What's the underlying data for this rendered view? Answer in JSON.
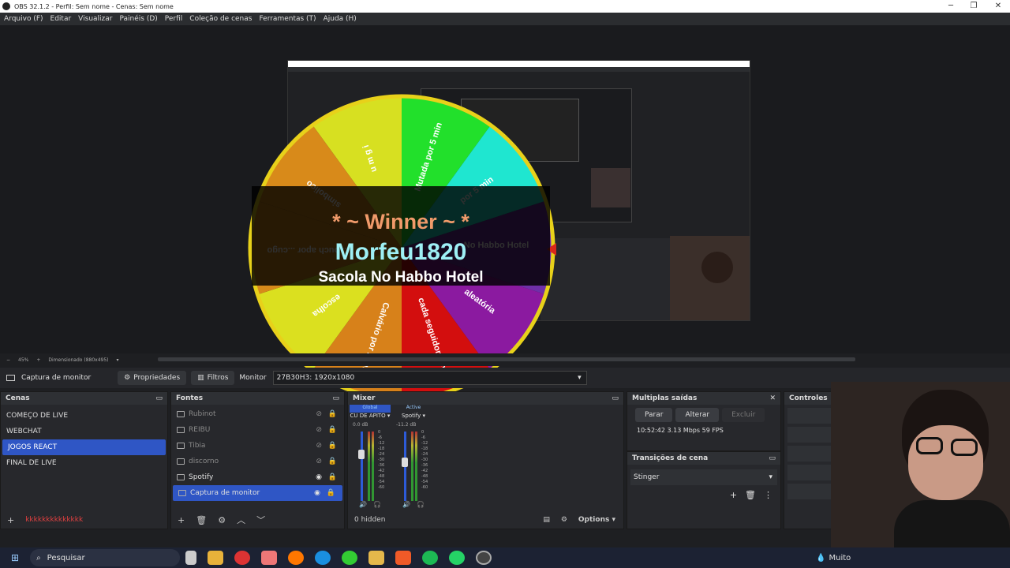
{
  "window": {
    "title": "OBS 32.1.2 - Perfil: Sem nome - Cenas: Sem nome",
    "min": "─",
    "max": "❐",
    "close": "✕"
  },
  "menu": [
    "Arquivo (F)",
    "Editar",
    "Visualizar",
    "Painéis (D)",
    "Perfil",
    "Coleção de cenas",
    "Ferramentas (T)",
    "Ajuda (H)"
  ],
  "wheel": {
    "winner_label": "* ~ Winner ~ *",
    "winner_name": "Morfeu1820",
    "prize": "Sacola No Habbo Hotel",
    "segments": [
      "u m g i",
      "Mutada por 5 min",
      "por 5 min",
      "No Habbo Hotel",
      "aleatória",
      "cada seguidor novo",
      "Calvário por 2 min",
      "escolha",
      "...ouch apor ...cugo",
      "simbolico"
    ],
    "segment_colors": [
      "#d7e021",
      "#22e02b",
      "#1fe6d0",
      "#6f2fa8",
      "#8b1aa0",
      "#d30e0e",
      "#d7811a",
      "#dbe01f",
      "#d78a1a",
      "#d88a1a"
    ],
    "rim_color": "#e8d11a"
  },
  "preview_status": {
    "zoom": "45%",
    "mode": "Dimensionado (880x495)"
  },
  "source_toolbar": {
    "source": "Captura de monitor",
    "properties": "Propriedades",
    "filters": "Filtros",
    "monitor_label": "Monitor",
    "monitor_value": "27B30H3: 1920x1080"
  },
  "scenes": {
    "title": "Cenas",
    "items": [
      "COMEÇO DE LIVE",
      "WEBCHAT",
      "JOGOS REACT",
      "FINAL DE LIVE"
    ],
    "selected": 2,
    "chat_overlay": "kkkkkkkkkkkkkk"
  },
  "sources": {
    "title": "Fontes",
    "items": [
      {
        "name": "Rubinot",
        "visible": false
      },
      {
        "name": "REIBU",
        "visible": false
      },
      {
        "name": "Tibia",
        "visible": false
      },
      {
        "name": "discorno",
        "visible": false
      },
      {
        "name": "Spotify",
        "visible": true
      },
      {
        "name": "Captura de monitor",
        "visible": true
      }
    ]
  },
  "mixer": {
    "title": "Mixer",
    "channels": [
      {
        "tag": "Global",
        "name": "CU DE APITO",
        "db": "0.0 dB",
        "level": 0.72
      },
      {
        "tag": "Active",
        "name": "Spotify",
        "db": "-11.2 dB",
        "level": 0.6
      }
    ],
    "scale": [
      "0",
      "-6",
      "-12",
      "-18",
      "-24",
      "-30",
      "-36",
      "-42",
      "-48",
      "-54",
      "-60"
    ],
    "hidden_count": "0 hidden",
    "options": "Options"
  },
  "outputs": {
    "title": "Multiplas saídas",
    "stop": "Parar",
    "change": "Alterar",
    "delete": "Excluir",
    "stats": "10:52:42  3.13 Mbps  59 FPS"
  },
  "transitions": {
    "title": "Transições de cena",
    "selected": "Stinger"
  },
  "controls": {
    "title": "Controles"
  },
  "taskbar": {
    "search": "Pesquisar",
    "weather": "Muito"
  }
}
